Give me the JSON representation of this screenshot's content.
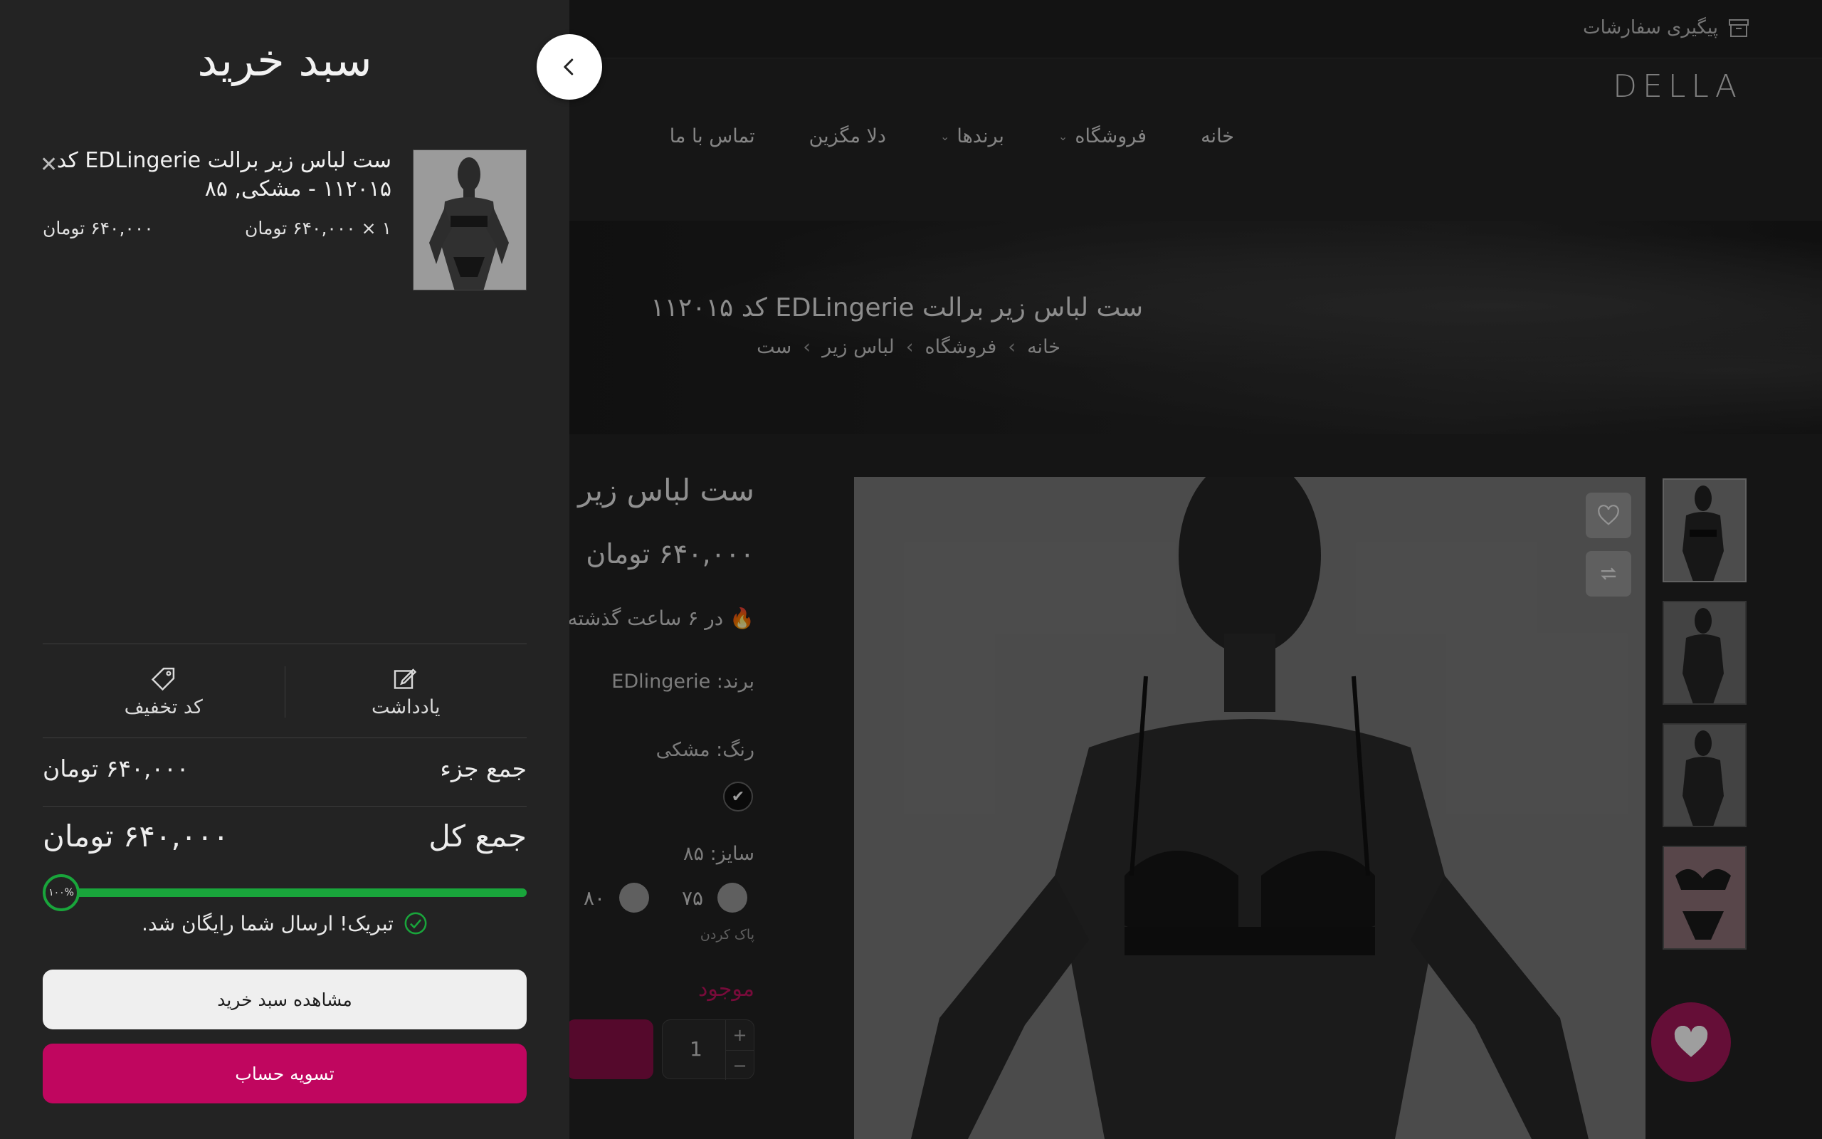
{
  "topbar": {
    "track_order": "پیگیری سفارشات"
  },
  "brand": {
    "logo": "DELLA"
  },
  "nav": {
    "items": [
      {
        "label": "خانه",
        "has_dropdown": false
      },
      {
        "label": "فروشگاه",
        "has_dropdown": true
      },
      {
        "label": "برندها",
        "has_dropdown": true
      },
      {
        "label": "دلا مگزین",
        "has_dropdown": false
      },
      {
        "label": "تماس با ما",
        "has_dropdown": false
      }
    ]
  },
  "hero": {
    "title": "ست لباس زیر برالت EDLingerie کد ۱۱۲۰۱۵",
    "breadcrumbs": [
      "خانه",
      "فروشگاه",
      "لباس زیر",
      "ست"
    ]
  },
  "product": {
    "title": "ست لباس زیر",
    "price": "۶۴۰,۰۰۰ تومان",
    "sales_note": "در ۶ ساعت گذشته",
    "brand": "برند: EDlingerie",
    "color_label": "رنگ: مشکی",
    "size_label": "سایز: ۸۵",
    "sizes": [
      "۸۰",
      "۷۵"
    ],
    "clear_label": "پاک کردن",
    "stock": "موجود",
    "quantity": "1"
  },
  "cart": {
    "title": "سبد خرید",
    "item": {
      "name": "ست لباس زیر برالت EDLingerie کد ۱۱۲۰۱۵ - مشکی, ۸۵",
      "qty_price": "۱ × ۶۴۰,۰۰۰ تومان",
      "line_total": "۶۴۰,۰۰۰ تومان"
    },
    "note_label": "یادداشت",
    "coupon_label": "کد تخفیف",
    "subtotal_label": "جمع جزء",
    "subtotal_value": "۶۴۰,۰۰۰ تومان",
    "total_label": "جمع کل",
    "total_value": "۶۴۰,۰۰۰ تومان",
    "shipping_progress": 1.0,
    "shipping_progress_text": "۱۰۰%",
    "free_shipping_msg": "تبریک! ارسال شما رایگان شد.",
    "view_cart_label": "مشاهده سبد خرید",
    "checkout_label": "تسویه حساب"
  },
  "colors": {
    "accent": "#c0065f",
    "progress": "#19a53b",
    "drawer_bg": "#232323"
  }
}
